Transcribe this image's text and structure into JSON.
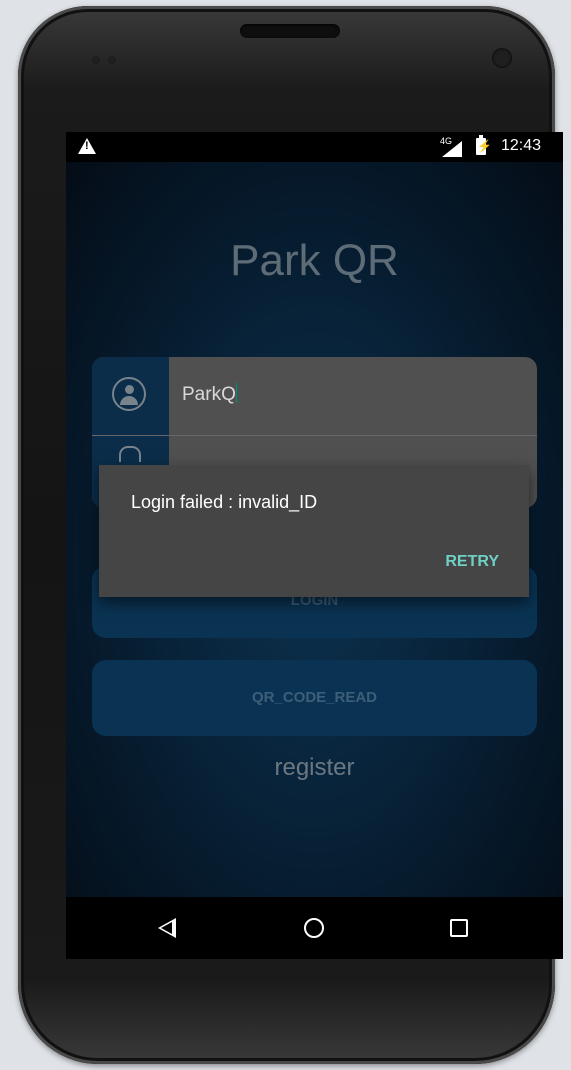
{
  "status_bar": {
    "network_label": "4G",
    "time": "12:43",
    "icons": [
      "warning-icon",
      "signal-icon",
      "battery-charging-icon"
    ]
  },
  "app": {
    "title": "Park QR",
    "username_value": "ParkQ",
    "login_button_label": "LOGIN",
    "qr_button_label": "QR_CODE_READ",
    "register_label": "register",
    "colors": {
      "background": "#0a2a45",
      "button": "#0c3c62",
      "field": "#5f5f5f",
      "title": "#6f7f8c"
    }
  },
  "dialog": {
    "message": "Login failed : invalid_ID",
    "action_label": "RETRY",
    "action_color": "#6fd0c4"
  },
  "nav_bar": {
    "icons": [
      "back-icon",
      "home-icon",
      "recent-apps-icon"
    ]
  }
}
